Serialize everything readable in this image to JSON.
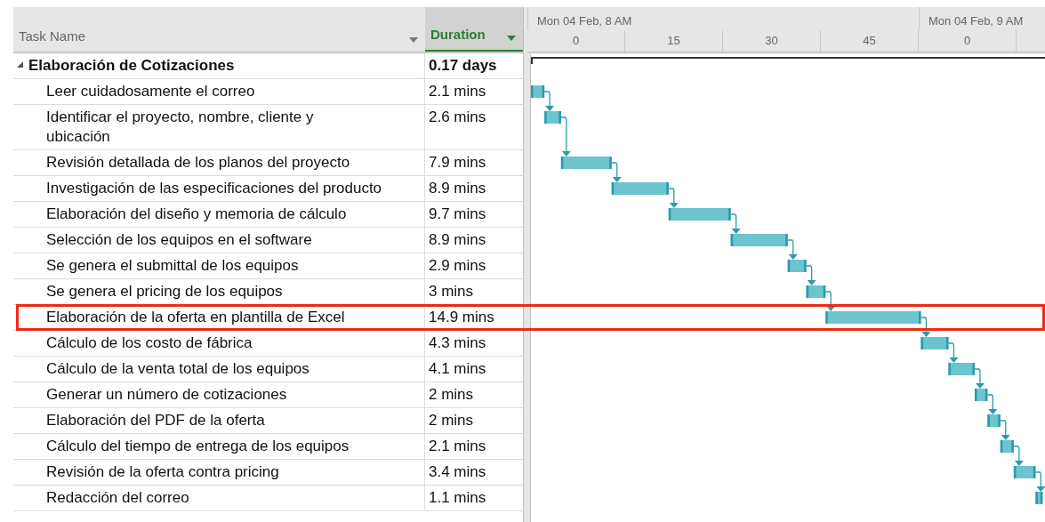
{
  "columns": [
    {
      "label": "Task Name",
      "selected": false
    },
    {
      "label": "Duration",
      "selected": true
    }
  ],
  "timescale": {
    "major": [
      "Mon 04 Feb, 8 AM",
      "Mon 04 Feb, 9 AM"
    ],
    "minor": [
      "0",
      "15",
      "30",
      "45",
      "0"
    ]
  },
  "rows": [
    {
      "kind": "summary",
      "name": "Elaboración de Cotizaciones",
      "duration": "0.17 days",
      "expanded": true,
      "highlighted": false
    },
    {
      "kind": "task",
      "name": "Leer cuidadosamente el correo",
      "duration": "2.1 mins",
      "highlighted": false
    },
    {
      "kind": "task",
      "name": "Identificar el proyecto, nombre, cliente y ubicación",
      "duration": "2.6 mins",
      "highlighted": false
    },
    {
      "kind": "task",
      "name": "Revisión detallada de los planos del proyecto",
      "duration": "7.9 mins",
      "highlighted": false
    },
    {
      "kind": "task",
      "name": "Investigación de las especificaciones del producto",
      "duration": "8.9 mins",
      "highlighted": false
    },
    {
      "kind": "task",
      "name": "Elaboración del diseño y memoria de cálculo",
      "duration": "9.7 mins",
      "highlighted": false
    },
    {
      "kind": "task",
      "name": "Selección de los equipos en el software",
      "duration": "8.9 mins",
      "highlighted": false
    },
    {
      "kind": "task",
      "name": "Se genera el submittal de los equipos",
      "duration": "2.9 mins",
      "highlighted": false
    },
    {
      "kind": "task",
      "name": "Se genera el pricing de los equipos",
      "duration": "3 mins",
      "highlighted": false
    },
    {
      "kind": "task",
      "name": "Elaboración de la oferta en plantilla de Excel",
      "duration": "14.9 mins",
      "highlighted": true
    },
    {
      "kind": "task",
      "name": "Cálculo de los costo de fábrica",
      "duration": "4.3 mins",
      "highlighted": false
    },
    {
      "kind": "task",
      "name": "Cálculo de la venta total de los equipos",
      "duration": "4.1 mins",
      "highlighted": false
    },
    {
      "kind": "task",
      "name": "Generar un número de cotizaciones",
      "duration": "2 mins",
      "highlighted": false
    },
    {
      "kind": "task",
      "name": "Elaboración del PDF de la oferta",
      "duration": "2 mins",
      "highlighted": false
    },
    {
      "kind": "task",
      "name": "Cálculo del tiempo de entrega de los equipos",
      "duration": "2.1 mins",
      "highlighted": false
    },
    {
      "kind": "task",
      "name": "Revisión de la oferta contra pricing",
      "duration": "3.4 mins",
      "highlighted": false
    },
    {
      "kind": "task",
      "name": "Redacción del correo",
      "duration": "1.1 mins",
      "highlighted": false
    }
  ]
}
